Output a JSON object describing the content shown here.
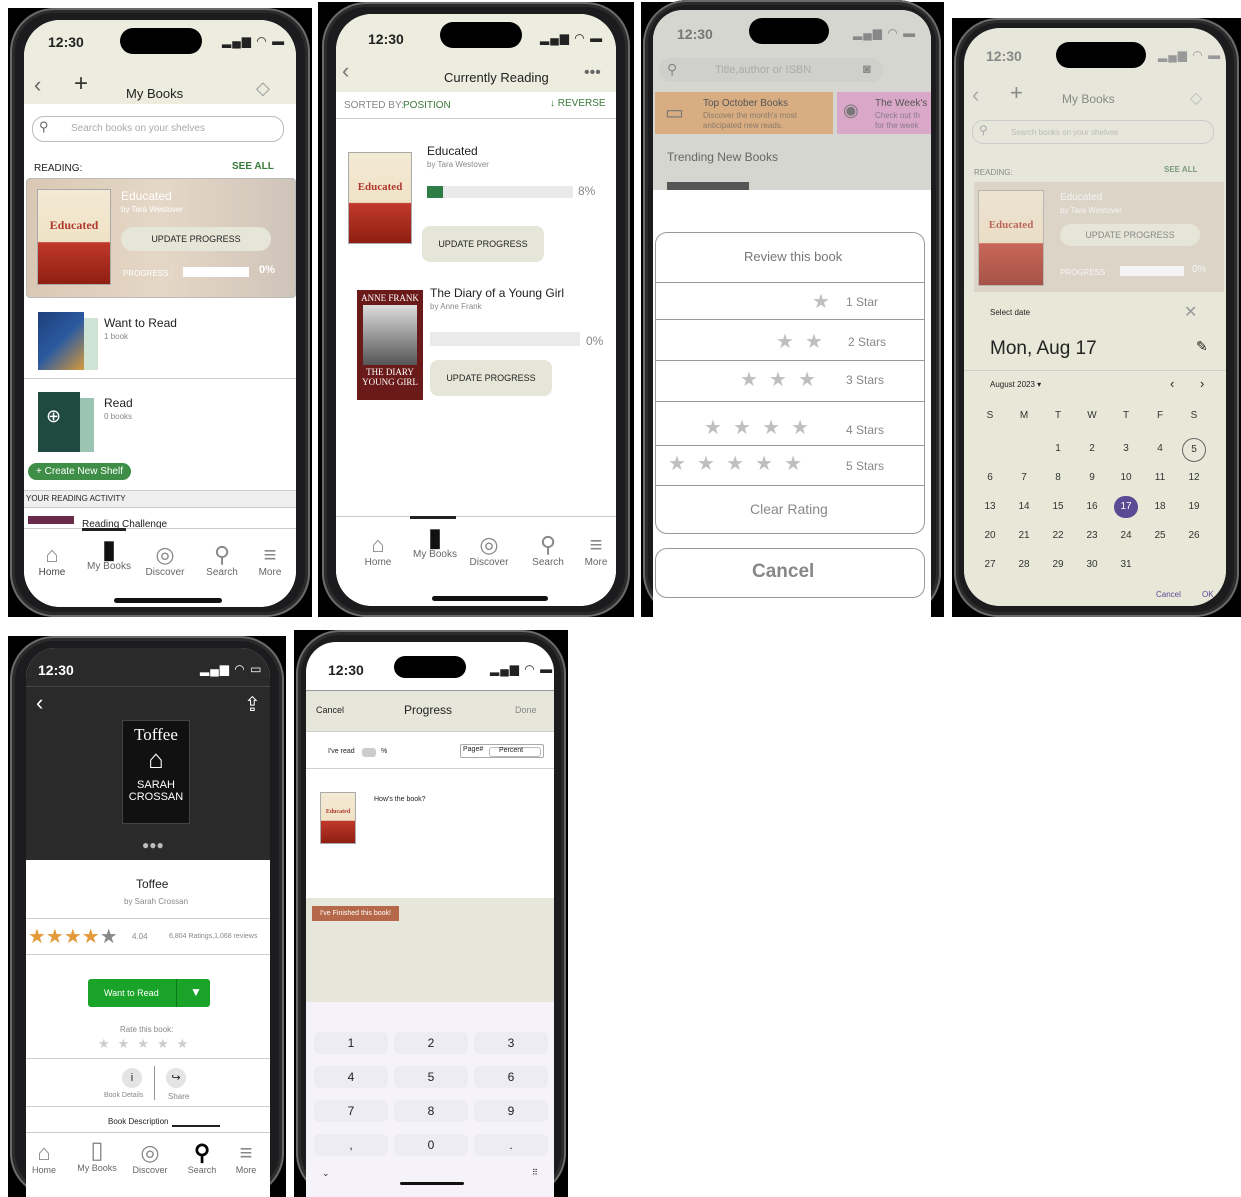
{
  "status": {
    "time": "12:30"
  },
  "s1": {
    "title": "My Books",
    "search_placeholder": "Search books on your shelves",
    "reading_label": "READING:",
    "see_all": "SEE ALL",
    "current_title": "Educated",
    "current_author": "by Tara Westover",
    "cover_text": "Educated",
    "update_progress": "UPDATE PROGRESS",
    "progress_label": "PROGRESS :",
    "progress_value": "0%",
    "shelves": [
      {
        "name": "Want to Read",
        "count": "1 book"
      },
      {
        "name": "Read",
        "count": "0 books"
      }
    ],
    "create_shelf": "+ Create New Shelf",
    "activity_label": "YOUR READING ACTIVITY",
    "challenge": "Reading Challenge"
  },
  "nav": {
    "home": "Home",
    "mybooks": "My Books",
    "discover": "Discover",
    "search": "Search",
    "more": "More"
  },
  "s2": {
    "title": "Currently Reading",
    "sorted_by": "SORTED BY:",
    "position": "POSITION",
    "reverse": "REVERSE",
    "books": [
      {
        "title": "Educated",
        "author": "by Tara Westover",
        "percent": "8%",
        "progress": 0.08,
        "button": "UPDATE PROGRESS",
        "cover": "Educated"
      },
      {
        "title": "The Diary of a Young Girl",
        "author": "by Anne Frank",
        "percent": "0%",
        "progress": 0,
        "button": "UPDATE PROGRESS",
        "cover_top": "ANNE FRANK",
        "cover_bottom": "THE DIARY",
        "cover_bottom2": "YOUNG GIRL"
      }
    ]
  },
  "s3": {
    "search_placeholder": "Title,author or ISBN",
    "card1_title": "Top October Books",
    "card1_sub1": "Discover the month's most",
    "card1_sub2": "anticipated new reads.",
    "card2_title": "The Week's",
    "card2_sub1": "Check out th",
    "card2_sub2": "for the week",
    "trending": "Trending New Books",
    "review_title": "Review this book",
    "ratings": [
      "1 Star",
      "2 Stars",
      "3 Stars",
      "4 Stars",
      "5 Stars"
    ],
    "clear": "Clear Rating",
    "cancel": "Cancel"
  },
  "s4": {
    "select_date": "Select date",
    "date": "Mon, Aug 17",
    "month": "August 2023",
    "weekdays": [
      "S",
      "M",
      "T",
      "W",
      "T",
      "F",
      "S"
    ],
    "days": [
      "1",
      "2",
      "3",
      "4",
      "5",
      "6",
      "7",
      "8",
      "9",
      "10",
      "11",
      "12",
      "13",
      "14",
      "15",
      "16",
      "17",
      "18",
      "19",
      "20",
      "21",
      "22",
      "23",
      "24",
      "25",
      "26",
      "27",
      "28",
      "29",
      "30",
      "31"
    ],
    "today": "5",
    "selected": "17",
    "cancel": "Cancel",
    "ok": "OK"
  },
  "s5": {
    "cover_title": "Toffee",
    "cover_author1": "SARAH",
    "cover_author2": "CROSSAN",
    "title": "Toffee",
    "author": "by Sarah Crossan",
    "rating": "4.04",
    "rating_value": 4.04,
    "ratings_count": "6,804 Ratings,1,068 reviews",
    "want": "Want to Read",
    "rate_label": "Rate this book:",
    "details": "Book Details",
    "share": "Share",
    "description": "Book Description",
    "nav_home": "Home"
  },
  "s6": {
    "cancel": "Cancel",
    "title": "Progress",
    "done": "Done",
    "ive_read": "I've read",
    "percent_sign": "%",
    "page": "Page#",
    "percent": "Percent",
    "hows": "How's the book?",
    "finished": "I've Finished this book!",
    "keys": [
      "1",
      "2",
      "3",
      "4",
      "5",
      "6",
      "7",
      "8",
      "9",
      ",",
      "0",
      "."
    ]
  }
}
